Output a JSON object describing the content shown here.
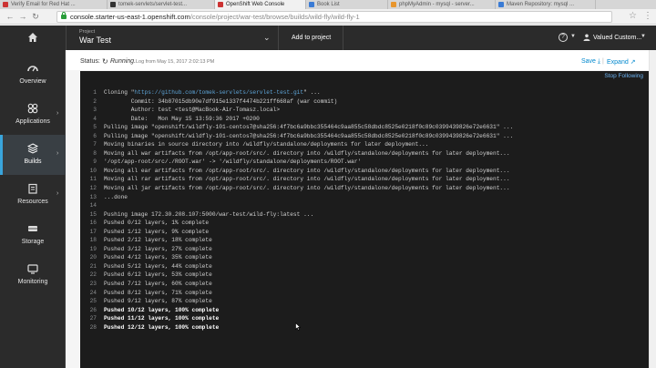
{
  "browser": {
    "tabs": [
      {
        "label": "Verify Email for Red Hat ..."
      },
      {
        "label": "tomek-servlets/servlet-test..."
      },
      {
        "label": "OpenShift Web Console"
      },
      {
        "label": "Book List"
      },
      {
        "label": "phpMyAdmin - mysql - server..."
      },
      {
        "label": "Maven Repository: mysql ..."
      }
    ],
    "url_host": "console.starter-us-east-1.openshift.com",
    "url_path": "/console/project/war-test/browse/builds/wild-fly/wild-fly-1"
  },
  "topnav": {
    "project_label": "Project",
    "project_name": "War Test",
    "add_to_project": "Add to project",
    "user_name": "Valued Custom..."
  },
  "sidebar": {
    "items": [
      {
        "label": "Overview",
        "icon": "dashboard-icon"
      },
      {
        "label": "Applications",
        "icon": "applications-icon"
      },
      {
        "label": "Builds",
        "icon": "builds-icon"
      },
      {
        "label": "Resources",
        "icon": "resources-icon"
      },
      {
        "label": "Storage",
        "icon": "storage-icon"
      },
      {
        "label": "Monitoring",
        "icon": "monitoring-icon"
      }
    ]
  },
  "status": {
    "label": "Status:",
    "value": "Running.",
    "log_info": "Log from May 15, 2017 2:02:13 PM",
    "save": "Save",
    "expand": "Expand"
  },
  "log": {
    "stop_following": "Stop Following",
    "lines": [
      {
        "n": "1",
        "text": "Cloning \"",
        "url": "https://github.com/tomek-servlets/servlet-test.git",
        "tail": "\" ..."
      },
      {
        "n": "2",
        "text": "        Commit: 34b87015db90e7df915e1337f4474b221ff668af (war commit)"
      },
      {
        "n": "3",
        "text": "        Author: test <test@MacBook-Air-Tomasz.local>"
      },
      {
        "n": "4",
        "text": "        Date:   Mon May 15 13:59:36 2017 +0200"
      },
      {
        "n": "5",
        "text": "Pulling image \"openshift/wildfly-101-centos7@sha256:4f7bc6a9bbc355464c9aa855c58dbdc8525e0218f0c89c0399439826e72e6631\" ..."
      },
      {
        "n": "6",
        "text": "Pulling image \"openshift/wildfly-101-centos7@sha256:4f7bc6a9bbc355464c9aa855c58dbdc8525e0218f0c89c0399439826e72e6631\" ..."
      },
      {
        "n": "7",
        "text": "Moving binaries in source directory into /wildfly/standalone/deployments for later deployment..."
      },
      {
        "n": "8",
        "text": "Moving all war artifacts from /opt/app-root/src/. directory into /wildfly/standalone/deployments for later deployment..."
      },
      {
        "n": "9",
        "text": "'/opt/app-root/src/./ROOT.war' -> '/wildfly/standalone/deployments/ROOT.war'"
      },
      {
        "n": "10",
        "text": "Moving all ear artifacts from /opt/app-root/src/. directory into /wildfly/standalone/deployments for later deployment..."
      },
      {
        "n": "11",
        "text": "Moving all rar artifacts from /opt/app-root/src/. directory into /wildfly/standalone/deployments for later deployment..."
      },
      {
        "n": "12",
        "text": "Moving all jar artifacts from /opt/app-root/src/. directory into /wildfly/standalone/deployments for later deployment..."
      },
      {
        "n": "13",
        "text": "...done"
      },
      {
        "n": "14",
        "text": ""
      },
      {
        "n": "15",
        "text": "Pushing image 172.30.208.107:5000/war-test/wild-fly:latest ..."
      },
      {
        "n": "16",
        "text": "Pushed 0/12 layers, 1% complete"
      },
      {
        "n": "17",
        "text": "Pushed 1/12 layers, 9% complete"
      },
      {
        "n": "18",
        "text": "Pushed 2/12 layers, 18% complete"
      },
      {
        "n": "19",
        "text": "Pushed 3/12 layers, 27% complete"
      },
      {
        "n": "20",
        "text": "Pushed 4/12 layers, 35% complete"
      },
      {
        "n": "21",
        "text": "Pushed 5/12 layers, 44% complete"
      },
      {
        "n": "22",
        "text": "Pushed 6/12 layers, 53% complete"
      },
      {
        "n": "23",
        "text": "Pushed 7/12 layers, 60% complete"
      },
      {
        "n": "24",
        "text": "Pushed 8/12 layers, 71% complete"
      },
      {
        "n": "25",
        "text": "Pushed 9/12 layers, 87% complete"
      },
      {
        "n": "26",
        "text": "Pushed 10/12 layers, 100% complete"
      },
      {
        "n": "27",
        "text": "Pushed 11/12 layers, 100% complete"
      },
      {
        "n": "28",
        "text": "Pushed 12/12 layers, 100% complete"
      }
    ]
  },
  "colors": {
    "nav_bg": "#2b2b2b",
    "active_accent": "#39a5dc",
    "link": "#0088ce",
    "log_bg": "#1c1c1c"
  }
}
